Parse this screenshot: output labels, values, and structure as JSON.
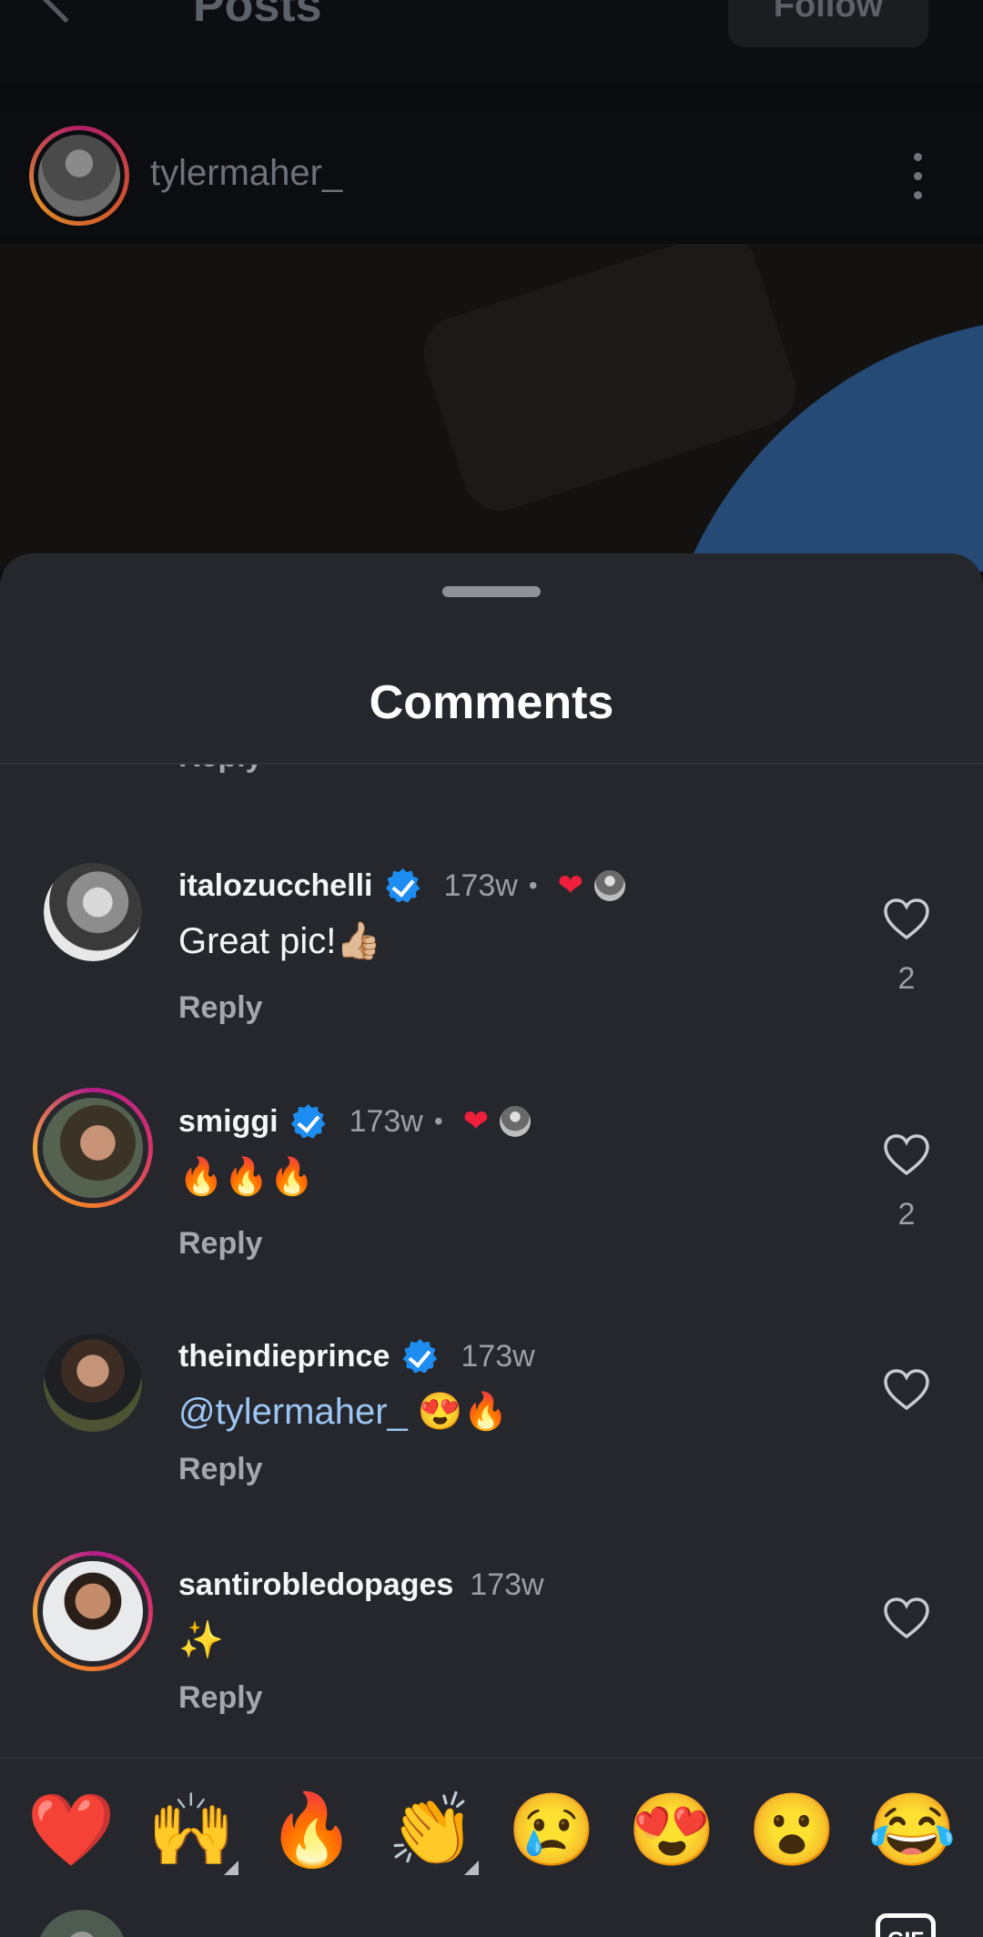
{
  "header": {
    "title": "Posts",
    "follow_label": "Follow"
  },
  "post": {
    "author": "tylermaher_"
  },
  "comments_sheet": {
    "title": "Comments",
    "partial_reply_label": "Reply",
    "comments": [
      {
        "username": "italozucchelli",
        "verified": true,
        "time": "173w",
        "liked_by_author": true,
        "text": "Great pic!👍🏼",
        "reply_label": "Reply",
        "likes": "2"
      },
      {
        "username": "smiggi",
        "verified": true,
        "time": "173w",
        "liked_by_author": true,
        "text": "🔥🔥🔥",
        "reply_label": "Reply",
        "likes": "2"
      },
      {
        "username": "theindieprince",
        "verified": true,
        "time": "173w",
        "liked_by_author": false,
        "mention": "@tylermaher_",
        "text": " 😍🔥",
        "reply_label": "Reply",
        "likes": ""
      },
      {
        "username": "santirobledopages",
        "verified": false,
        "time": "173w",
        "liked_by_author": false,
        "text": "✨",
        "reply_label": "Reply",
        "likes": ""
      }
    ],
    "quick_reactions": [
      "❤️",
      "🙌",
      "🔥",
      "👏",
      "😢",
      "😍",
      "😮",
      "😂"
    ]
  },
  "composer": {
    "gif_label": "GIF"
  },
  "colors": {
    "sheet_background": "#25272c",
    "verified": "#1d8df2",
    "liked_heart": "#ef1f3b",
    "mention": "#9cc6f5"
  }
}
